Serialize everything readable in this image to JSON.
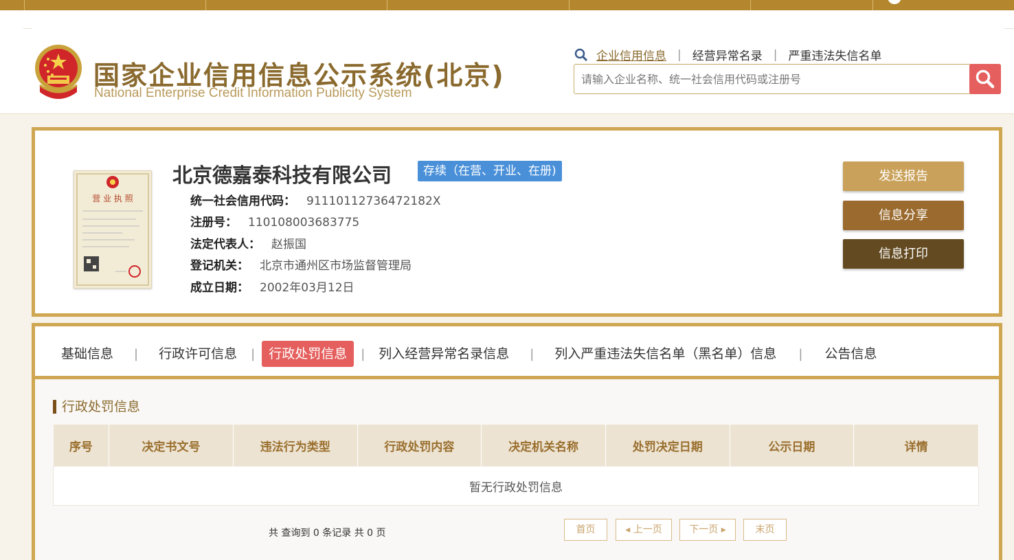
{
  "header": {
    "title_cn": "国家企业信用信息公示系统(北京)",
    "title_en": "National Enterprise Credit Information Publicity System",
    "links": [
      "企业信用信息",
      "经营异常名录",
      "严重违法失信名单"
    ],
    "search_placeholder": "请输入企业名称、统一社会信用代码或注册号"
  },
  "company": {
    "name": "北京德嘉泰科技有限公司",
    "status": "存续（在营、开业、在册)",
    "fields": [
      {
        "label": "统一社会信用代码：",
        "value": "91110112736472182X"
      },
      {
        "label": "注册号：",
        "value": "110108003683775"
      },
      {
        "label": "法定代表人：",
        "value": "赵振国"
      },
      {
        "label": "登记机关：",
        "value": "北京市通州区市场监督管理局"
      },
      {
        "label": "成立日期：",
        "value": "2002年03月12日"
      }
    ],
    "license_title": "营 业 执 照"
  },
  "actions": {
    "send_report": "发送报告",
    "share": "信息分享",
    "print": "信息打印"
  },
  "tabs": [
    "基础信息",
    "行政许可信息",
    "行政处罚信息",
    "列入经营异常名录信息",
    "列入严重违法失信名单（黑名单）信息",
    "公告信息"
  ],
  "active_tab": "行政处罚信息",
  "section": {
    "title": "行政处罚信息",
    "columns": [
      "序号",
      "决定书文号",
      "违法行为类型",
      "行政处罚内容",
      "决定机关名称",
      "处罚决定日期",
      "公示日期",
      "详情"
    ],
    "empty_text": "暂无行政处罚信息"
  },
  "pager": {
    "info": "共 查询到 0 条记录 共 0 页",
    "first": "首页",
    "prev": "◂ 上一页",
    "next": "下一页 ▸",
    "last": "末页"
  },
  "colors": {
    "gold": "#cfa652",
    "brown_dark": "#634a20",
    "red": "#e45f5d",
    "blue_badge": "#4a90d9"
  }
}
